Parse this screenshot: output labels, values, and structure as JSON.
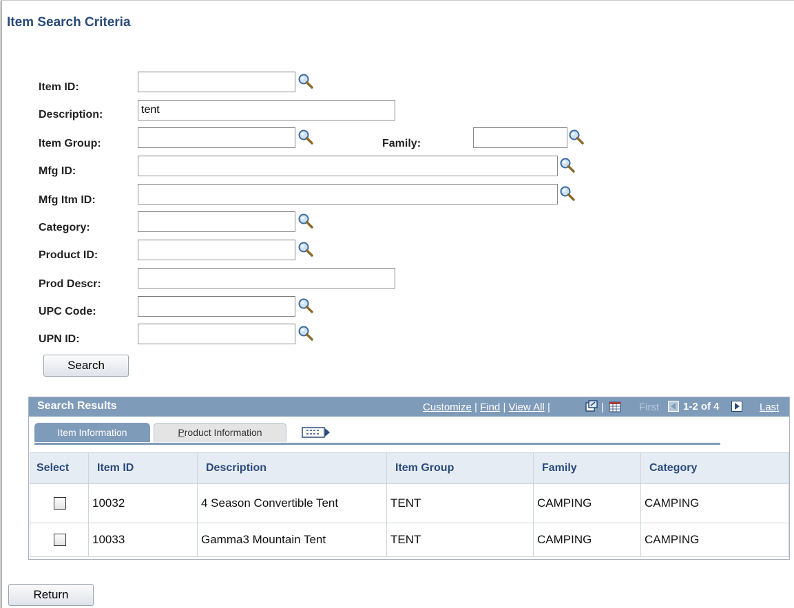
{
  "page": {
    "title": "Item Search Criteria"
  },
  "form": {
    "item_id": {
      "label": "Item ID:",
      "value": ""
    },
    "description": {
      "label": "Description:",
      "value": "tent"
    },
    "item_group": {
      "label": "Item Group:",
      "value": ""
    },
    "family": {
      "label": "Family:",
      "value": ""
    },
    "mfg_id": {
      "label": "Mfg ID:",
      "value": ""
    },
    "mfg_itm_id": {
      "label": "Mfg Itm ID:",
      "value": ""
    },
    "category": {
      "label": "Category:",
      "value": ""
    },
    "product_id": {
      "label": "Product ID:",
      "value": ""
    },
    "prod_descr": {
      "label": "Prod Descr:",
      "value": ""
    },
    "upc_code": {
      "label": "UPC Code:",
      "value": ""
    },
    "upn_id": {
      "label": "UPN ID:",
      "value": ""
    },
    "search_label": "Search"
  },
  "results": {
    "title": "Search Results",
    "nav": {
      "customize": "Customize",
      "find": "Find",
      "view_all": "View All",
      "first": "First",
      "range": "1-2 of 4",
      "last": "Last"
    },
    "tabs": [
      {
        "label": "Item Information",
        "active": true
      },
      {
        "label": "Product Information",
        "active": false
      }
    ],
    "columns": [
      "Select",
      "Item ID",
      "Description",
      "Item Group",
      "Family",
      "Category"
    ],
    "rows": [
      {
        "item_id": "10032",
        "description": "4 Season Convertible Tent",
        "item_group": "TENT",
        "family": "CAMPING",
        "category": "CAMPING"
      },
      {
        "item_id": "10033",
        "description": "Gamma3 Mountain Tent",
        "item_group": "TENT",
        "family": "CAMPING",
        "category": "CAMPING"
      }
    ]
  },
  "footer": {
    "return_label": "Return"
  },
  "icons": {
    "lookup": "magnifier-lookup-icon",
    "zoom": "new-window-icon",
    "download": "spreadsheet-download-icon",
    "prev": "arrow-left-icon",
    "next": "arrow-right-icon",
    "show_all_columns": "show-all-columns-icon"
  },
  "colors": {
    "title": "#2a4a7a",
    "header_bar": "#7f9bba",
    "column_header_bg": "#e6ecf3"
  }
}
